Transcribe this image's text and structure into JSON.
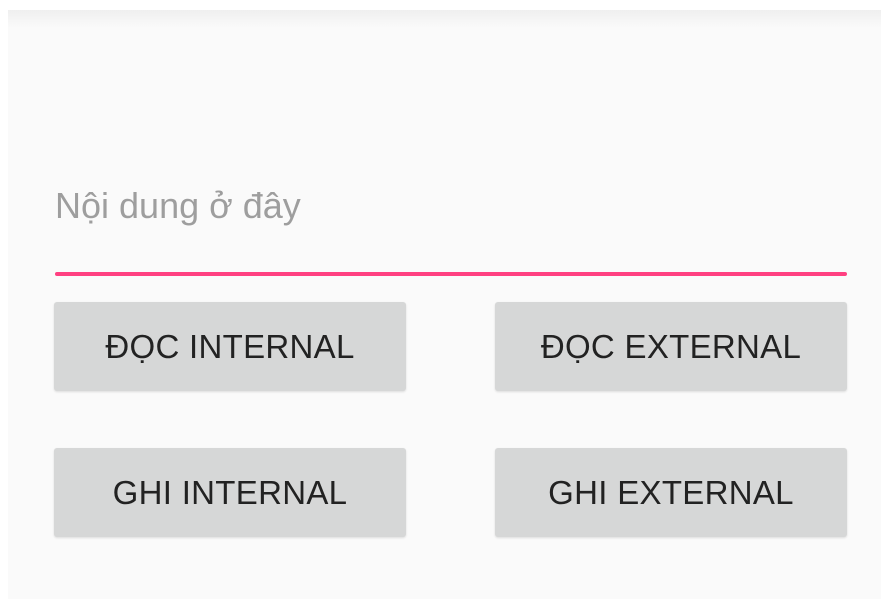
{
  "content": {
    "input_value": "",
    "input_placeholder": "Nội dung ở đây"
  },
  "buttons": {
    "read_internal": "ĐỌC INTERNAL",
    "read_external": "ĐỌC EXTERNAL",
    "write_internal": "GHI INTERNAL",
    "write_external": "GHI EXTERNAL"
  },
  "colors": {
    "accent": "#ff4081",
    "button_bg": "#d6d7d7",
    "button_text": "#222222",
    "background": "#fafafa",
    "placeholder": "#9e9e9e"
  }
}
